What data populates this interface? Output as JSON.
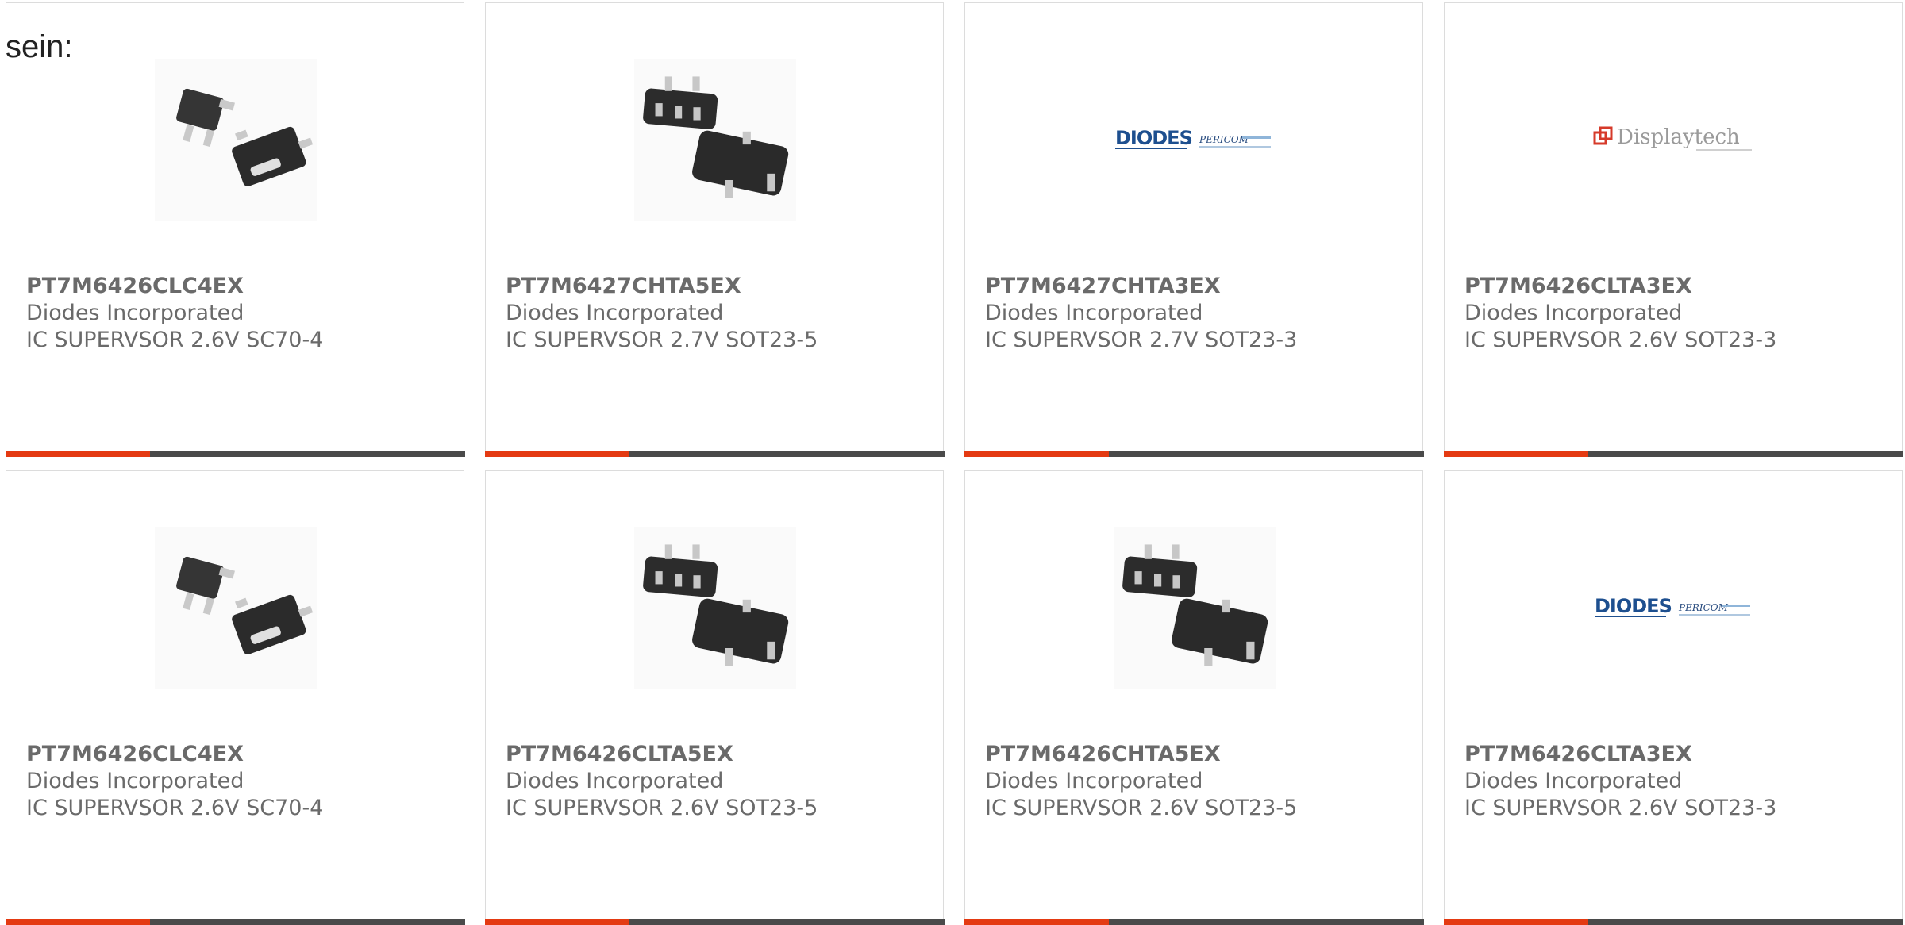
{
  "intro_text": "sein:",
  "colors": {
    "accent": "#e43a12",
    "bar_dark": "#4a4a4a",
    "text": "#6a6a6a",
    "border": "#dcdcdc"
  },
  "products": [
    {
      "part_number": "PT7M6426CLC4EX",
      "manufacturer": "Diodes Incorporated",
      "description": "IC SUPERVSOR 2.6V SC70-4",
      "image": "sc70-4-package-image"
    },
    {
      "part_number": "PT7M6427CHTA5EX",
      "manufacturer": "Diodes Incorporated",
      "description": "IC SUPERVSOR 2.7V SOT23-5",
      "image": "sot23-5-package-image"
    },
    {
      "part_number": "PT7M6427CHTA3EX",
      "manufacturer": "Diodes Incorporated",
      "description": "IC SUPERVSOR 2.7V SOT23-3",
      "image": "diodes-pericom-logo",
      "logo_text": "DIODES",
      "logo_subtext": "PERICOM"
    },
    {
      "part_number": "PT7M6426CLTA3EX",
      "manufacturer": "Diodes Incorporated",
      "description": "IC SUPERVSOR 2.6V SOT23-3",
      "image": "displaytech-logo",
      "logo_text": "Displaytech"
    },
    {
      "part_number": "PT7M6426CLC4EX",
      "manufacturer": "Diodes Incorporated",
      "description": "IC SUPERVSOR 2.6V SC70-4",
      "image": "sc70-4-package-image"
    },
    {
      "part_number": "PT7M6426CLTA5EX",
      "manufacturer": "Diodes Incorporated",
      "description": "IC SUPERVSOR 2.6V SOT23-5",
      "image": "sot23-5-package-image"
    },
    {
      "part_number": "PT7M6426CHTA5EX",
      "manufacturer": "Diodes Incorporated",
      "description": "IC SUPERVSOR 2.6V SOT23-5",
      "image": "sot23-5-package-image"
    },
    {
      "part_number": "PT7M6426CLTA3EX",
      "manufacturer": "Diodes Incorporated",
      "description": "IC SUPERVSOR 2.6V SOT23-3",
      "image": "diodes-pericom-logo",
      "logo_text": "DIODES",
      "logo_subtext": "PERICOM"
    }
  ]
}
